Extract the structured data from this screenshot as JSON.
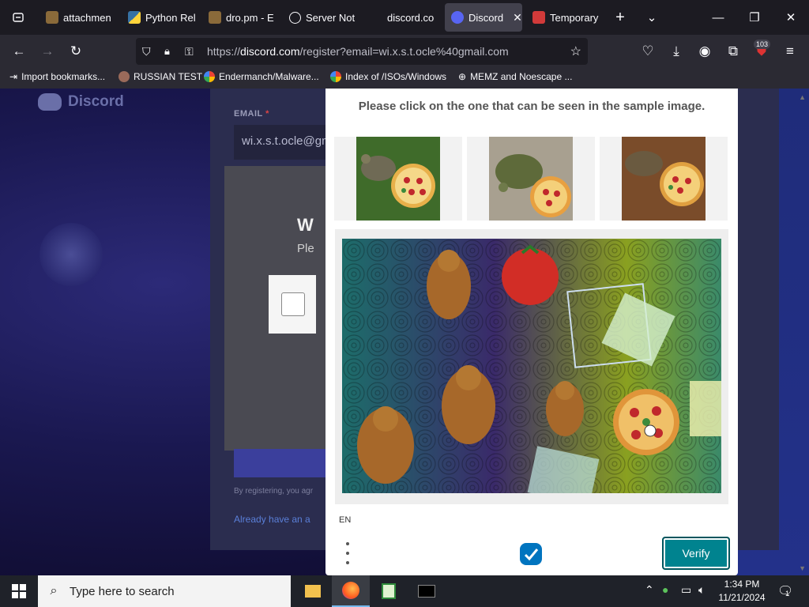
{
  "browser": {
    "tabs": [
      {
        "label": "attachmen",
        "icon": "folder-icon",
        "active": false
      },
      {
        "label": "Python Rel",
        "icon": "python-icon",
        "active": false
      },
      {
        "label": "dro.pm - E",
        "icon": "folder-icon",
        "active": false
      },
      {
        "label": "Server Not",
        "icon": "info-icon",
        "active": false
      },
      {
        "label": "discord.co",
        "icon": "",
        "active": false
      },
      {
        "label": "Discord",
        "icon": "discord-icon",
        "active": true
      },
      {
        "label": "Temporary",
        "icon": "mail-icon",
        "active": false
      }
    ],
    "url_prefix": "https://",
    "url_host": "discord.com",
    "url_path": "/register?email=wi.x.s.t.ocle%40gmail.com",
    "extension_badge": "103",
    "bookmarks": [
      {
        "label": "Import bookmarks...",
        "icon": "import-icon"
      },
      {
        "label": "RUSSIAN TEST",
        "icon": "github-icon"
      },
      {
        "label": "Endermanch/Malware...",
        "icon": "google-icon"
      },
      {
        "label": "Index of /ISOs/Windows",
        "icon": "google-icon"
      },
      {
        "label": "MEMZ and Noescape ...",
        "icon": "globe-icon"
      }
    ]
  },
  "discord_page": {
    "logo_text": "Discord",
    "email_label": "EMAIL",
    "email_required": "*",
    "email_value": "wi.x.s.t.ocle@gm",
    "modal_title_partial": "W",
    "modal_sub_partial": "Ple",
    "small_text": "By registering, you agr",
    "login_link": "Already have an a"
  },
  "captcha": {
    "prompt": "Please click on the one that can be seen in the sample image.",
    "samples": [
      {
        "name": "sample-turtle-pizza-grass",
        "bg": "#3f6b2a"
      },
      {
        "name": "sample-turtle-pizza-tiles",
        "bg": "#9c9a8c"
      },
      {
        "name": "sample-turtle-pizza-table",
        "bg": "#6b4226"
      }
    ],
    "language": "EN",
    "verify_label": "Verify",
    "accent": "#00838f"
  },
  "taskbar": {
    "search_placeholder": "Type here to search",
    "time": "1:34 PM",
    "date": "11/21/2024",
    "notification_count": "1"
  }
}
